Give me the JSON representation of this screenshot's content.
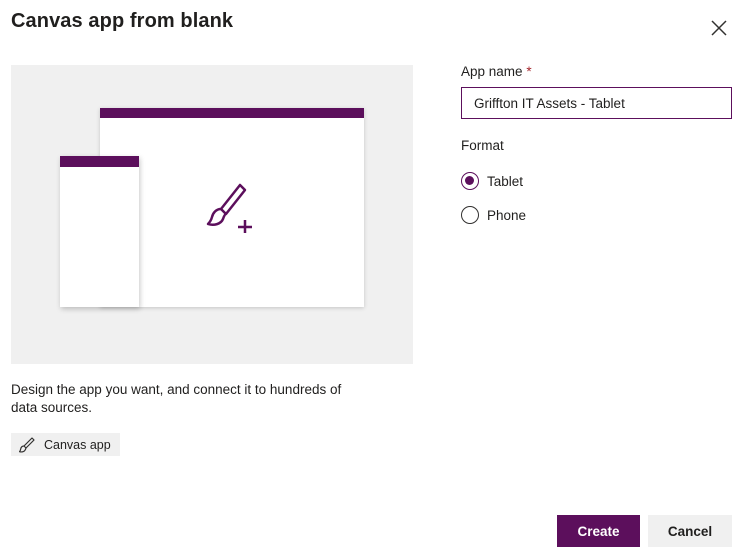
{
  "dialog": {
    "title": "Canvas app from blank",
    "close_icon": "close-icon"
  },
  "preview": {
    "accent_color": "#5c0f5c",
    "background_color": "#f0f0f0",
    "illustration_icon": "paintbrush-plus-icon",
    "description": "Design the app you want, and connect it to hundreds of data sources.",
    "tag_icon": "paintbrush-icon",
    "tag_label": "Canvas app"
  },
  "form": {
    "app_name_label": "App name",
    "required_marker": "*",
    "app_name_value": "Griffton IT Assets - Tablet",
    "format_label": "Format",
    "format_options": [
      {
        "label": "Tablet",
        "selected": true
      },
      {
        "label": "Phone",
        "selected": false
      }
    ]
  },
  "actions": {
    "create_label": "Create",
    "cancel_label": "Cancel"
  }
}
